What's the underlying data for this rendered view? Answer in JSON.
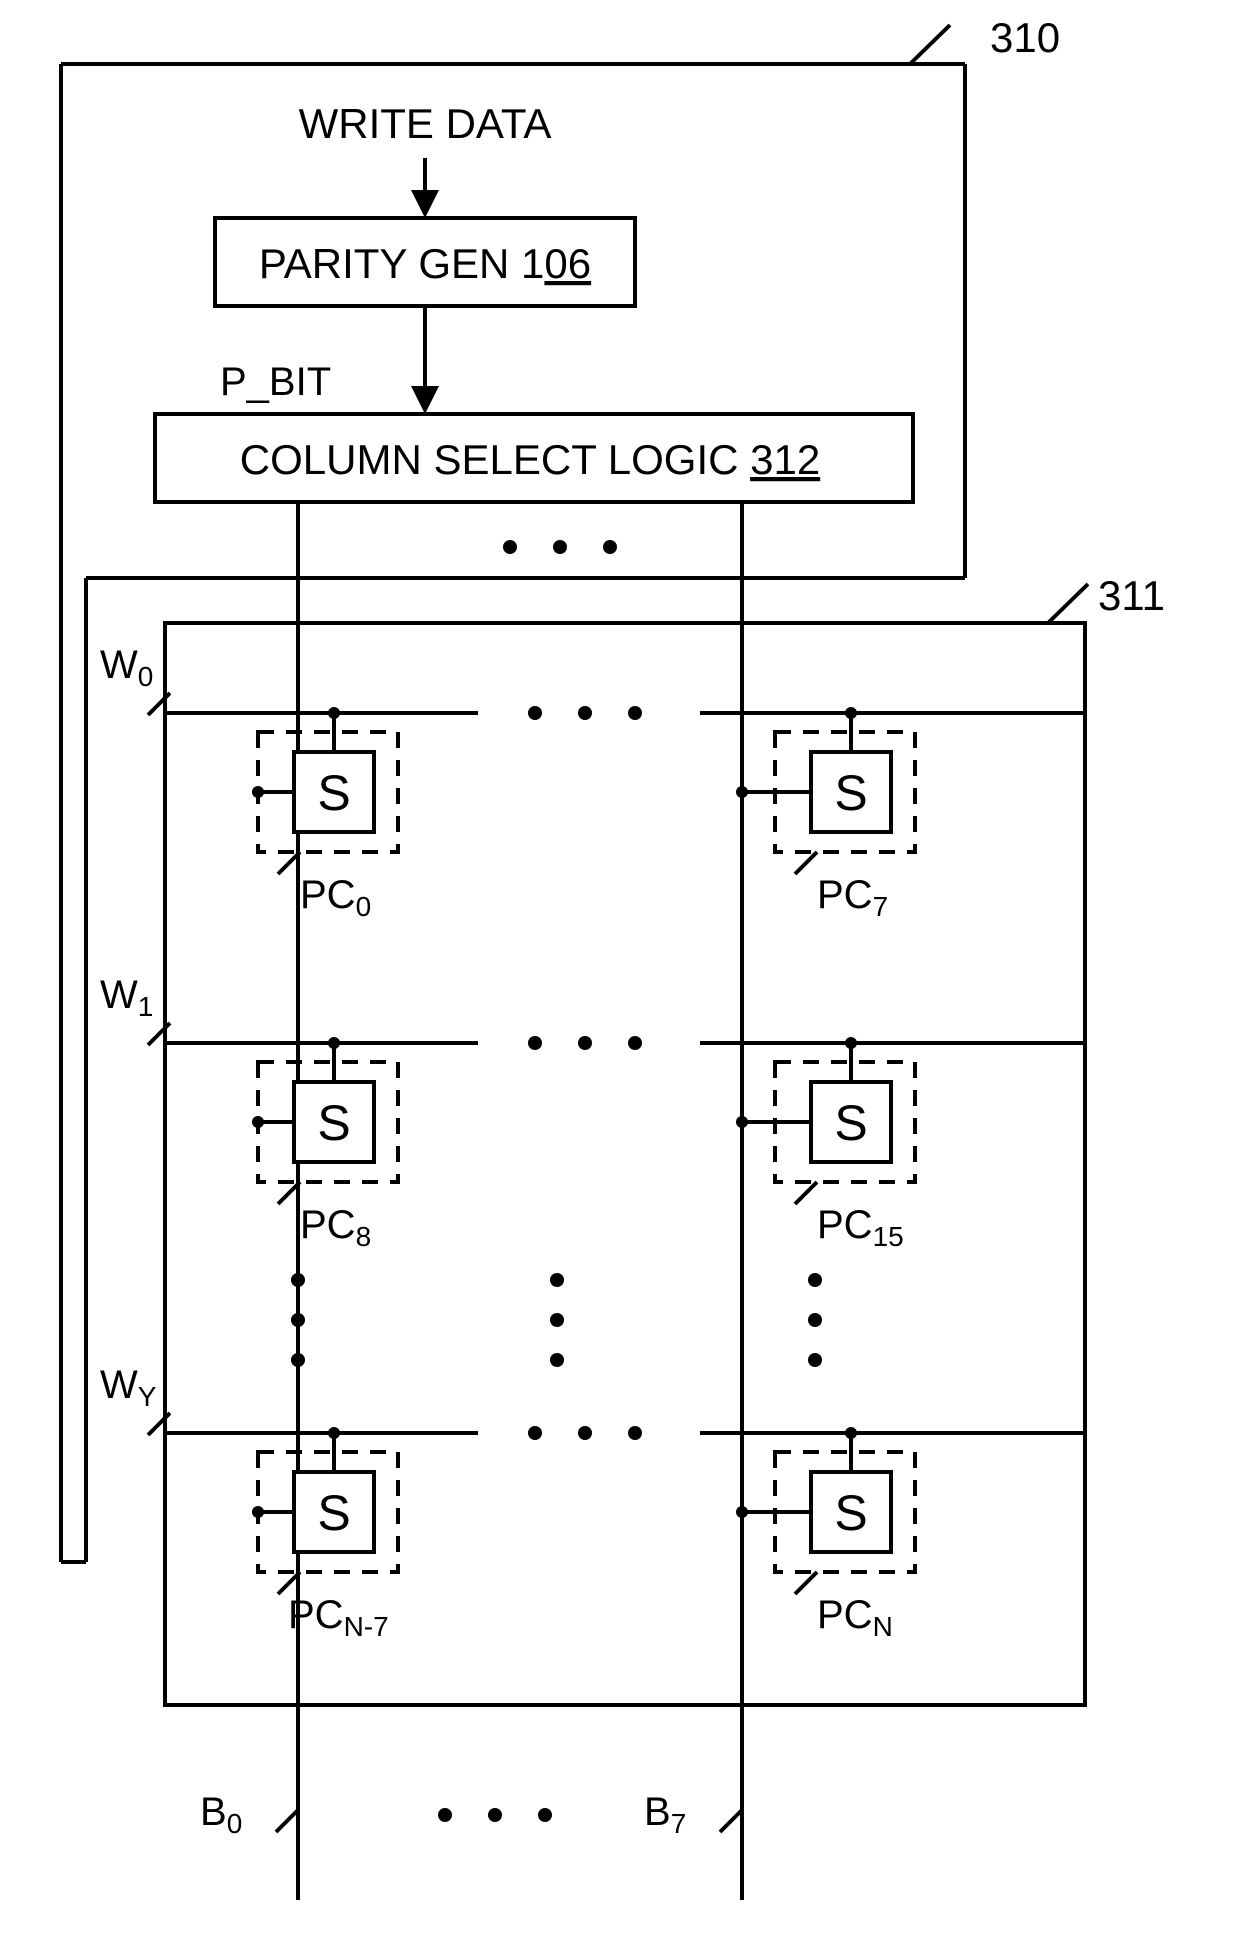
{
  "labels": {
    "outer_ref": "310",
    "array_ref": "311",
    "write_data": "WRITE DATA",
    "parity_gen_prefix": "PARITY GEN 1",
    "parity_gen_suffix": "06",
    "p_bit": "P_BIT",
    "col_sel_prefix": "COLUMN SELECT LOGIC ",
    "col_sel_suffix": "312",
    "S": "S",
    "W0": "W",
    "W0_sub": "0",
    "W1": "W",
    "W1_sub": "1",
    "WY": "W",
    "WY_sub": "Y",
    "PC0": "PC",
    "PC0_sub": "0",
    "PC7": "PC",
    "PC7_sub": "7",
    "PC8": "PC",
    "PC8_sub": "8",
    "PC15": "PC",
    "PC15_sub": "15",
    "PCn7": "PC",
    "PCn7_sub": "N-7",
    "PCn": "PC",
    "PCn_sub": "N",
    "B0": "B",
    "B0_sub": "0",
    "B7": "B",
    "B7_sub": "7"
  }
}
